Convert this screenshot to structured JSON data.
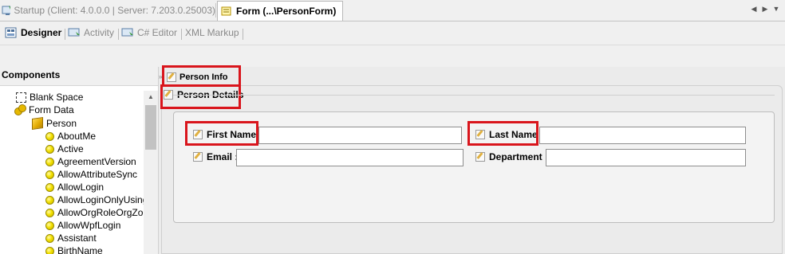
{
  "doc_tabs": [
    {
      "label": "Startup (Client: 4.0.0.0 | Server: 7.203.0.25003)",
      "active": false
    },
    {
      "label": "Form (...\\PersonForm)",
      "active": true
    }
  ],
  "view_tabs": [
    {
      "label": "Designer",
      "active": true
    },
    {
      "label": "Activity",
      "active": false
    },
    {
      "label": "C# Editor",
      "active": false
    },
    {
      "label": "XML Markup",
      "active": false
    }
  ],
  "components": {
    "title": "Components",
    "tree": [
      {
        "label": "Blank Space",
        "icon": "blank-space-icon",
        "indent": 0
      },
      {
        "label": "Form Data",
        "icon": "form-data-icon",
        "indent": 0
      },
      {
        "label": "Person",
        "icon": "person-entity-icon",
        "indent": 1
      },
      {
        "label": "AboutMe",
        "icon": "field-icon",
        "indent": 2
      },
      {
        "label": "Active",
        "icon": "field-icon",
        "indent": 2
      },
      {
        "label": "AgreementVersion",
        "icon": "field-icon",
        "indent": 2
      },
      {
        "label": "AllowAttributeSync",
        "icon": "field-icon",
        "indent": 2
      },
      {
        "label": "AllowLogin",
        "icon": "field-icon",
        "indent": 2
      },
      {
        "label": "AllowLoginOnlyUsing",
        "icon": "field-icon",
        "indent": 2
      },
      {
        "label": "AllowOrgRoleOrgZo",
        "icon": "field-icon",
        "indent": 2
      },
      {
        "label": "AllowWpfLogin",
        "icon": "field-icon",
        "indent": 2
      },
      {
        "label": "Assistant",
        "icon": "field-icon",
        "indent": 2
      },
      {
        "label": "BirthName",
        "icon": "field-icon",
        "indent": 2
      }
    ]
  },
  "designer": {
    "tab_label": "Person Info",
    "group_label": "Person Details",
    "fields": [
      {
        "label": "First Name :",
        "value": ""
      },
      {
        "label": "Last Name :",
        "value": ""
      },
      {
        "label": "Email :",
        "value": ""
      },
      {
        "label": "Department :",
        "value": ""
      }
    ]
  },
  "colors": {
    "highlight": "#d9151c"
  }
}
